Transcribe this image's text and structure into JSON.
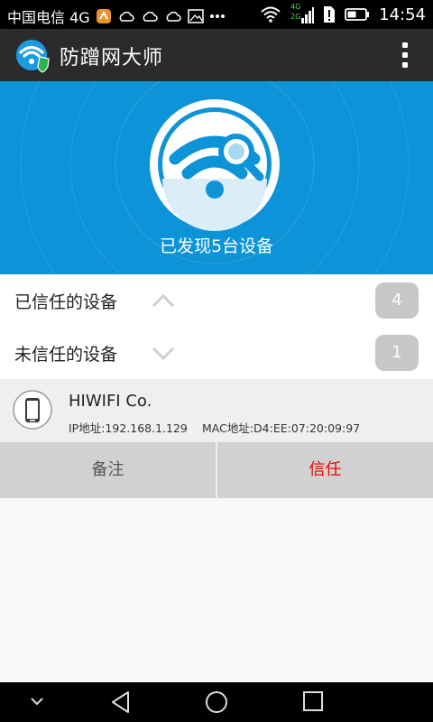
{
  "status_bar": {
    "carrier": "中国电信 4G",
    "time": "14:54",
    "icons": [
      "app-notification-icon",
      "cloud-icon",
      "cloud-icon",
      "cloud-icon",
      "image-icon",
      "more-dots-icon",
      "wifi-icon",
      "signal-icon",
      "sim-alert-icon",
      "battery-icon"
    ],
    "network_small": [
      "4G",
      "2G"
    ]
  },
  "app_bar": {
    "title": "防蹭网大师",
    "logo_icon": "wifi-shield-icon",
    "menu_icon": "overflow-menu-icon"
  },
  "hero": {
    "status_text": "已发现5台设备",
    "emblem_icon": "wifi-search-icon"
  },
  "trusted": {
    "label": "已信任的设备",
    "count": "4",
    "chevron": "chevron-up-icon"
  },
  "untrusted": {
    "label": "未信任的设备",
    "count": "1",
    "chevron": "chevron-down-icon"
  },
  "device": {
    "name": "HIWIFI Co.",
    "ip": "IP地址:192.168.1.129",
    "mac": "MAC地址:D4:EE:07:20:09:97",
    "icon": "smartphone-icon"
  },
  "actions": {
    "note": "备注",
    "trust": "信任"
  },
  "nav": {
    "icons": [
      "hide-keyboard-icon",
      "back-icon",
      "home-icon",
      "recents-icon"
    ]
  },
  "colors": {
    "hero_blue": "#0d93d8",
    "app_bar": "#2b2b2b",
    "trust_red": "#ee0000",
    "count_badge": "#c7c7c7"
  }
}
